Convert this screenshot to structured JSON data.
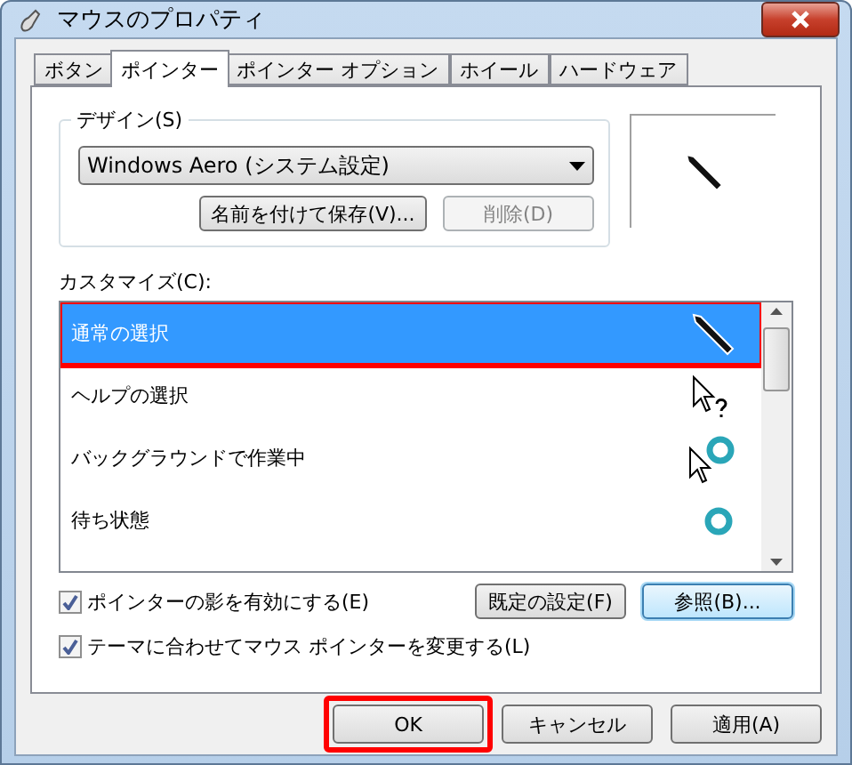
{
  "window": {
    "title": "マウスのプロパティ"
  },
  "tabs": [
    {
      "label": "ボタン",
      "selected": false
    },
    {
      "label": "ポインター",
      "selected": true
    },
    {
      "label": "ポインター オプション",
      "selected": false
    },
    {
      "label": "ホイール",
      "selected": false
    },
    {
      "label": "ハードウェア",
      "selected": false
    }
  ],
  "design": {
    "label": "デザイン(S)",
    "scheme": "Windows Aero (システム設定)",
    "buttons": [
      {
        "label": "名前を付けて保存(V)...",
        "disabled": false
      },
      {
        "label": "削除(D)",
        "disabled": true
      }
    ]
  },
  "customize": {
    "label": "カスタマイズ(C):",
    "rows": [
      {
        "name": "通常の選択",
        "kind": "pen",
        "selected": true,
        "highlighted": true
      },
      {
        "name": "ヘルプの選択",
        "kind": "help",
        "selected": false,
        "highlighted": false
      },
      {
        "name": "バックグラウンドで作業中",
        "kind": "working",
        "selected": false,
        "highlighted": false
      },
      {
        "name": "待ち状態",
        "kind": "busy",
        "selected": false,
        "highlighted": false
      }
    ]
  },
  "options": [
    {
      "label": "ポインターの影を有効にする(E)",
      "checked": true
    },
    {
      "label": "テーマに合わせてマウス ポインターを変更する(L)",
      "checked": true
    }
  ],
  "pointer_buttons": [
    {
      "label": "既定の設定(F)",
      "focused": false
    },
    {
      "label": "参照(B)...",
      "focused": true
    }
  ],
  "dialog_buttons": [
    {
      "label": "OK",
      "highlighted": true
    },
    {
      "label": "キャンセル",
      "highlighted": false
    },
    {
      "label": "適用(A)",
      "highlighted": false
    }
  ]
}
